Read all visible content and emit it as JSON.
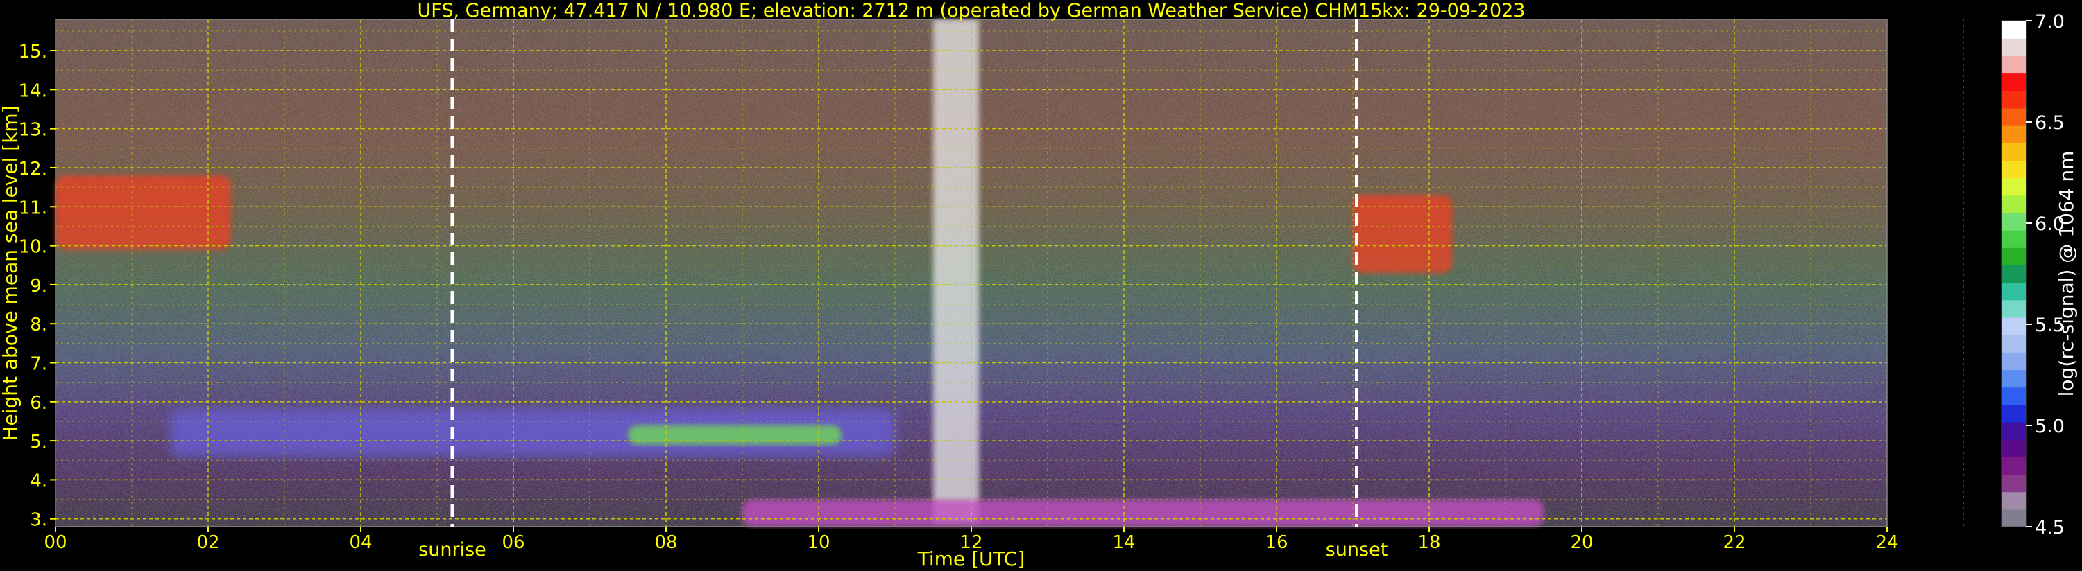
{
  "chart_data": {
    "type": "heatmap",
    "title": "UFS, Germany; 47.417 N / 10.980 E; elevation: 2712 m  (operated by German Weather Service)    CHM15kx: 29-09-2023",
    "xlabel": "Time [UTC]",
    "ylabel": "Height above mean sea level [km]",
    "xlim": [
      0,
      24
    ],
    "ylim": [
      2.8,
      15.8
    ],
    "x_ticks": [
      0,
      2,
      4,
      6,
      8,
      10,
      12,
      14,
      16,
      18,
      20,
      22,
      24
    ],
    "x_tick_labels": [
      "00",
      "02",
      "04",
      "06",
      "08",
      "10",
      "12",
      "14",
      "16",
      "18",
      "20",
      "22",
      "24"
    ],
    "y_ticks": [
      3,
      4,
      5,
      6,
      7,
      8,
      9,
      10,
      11,
      12,
      13,
      14,
      15
    ],
    "y_tick_labels": [
      "3.",
      "4.",
      "5.",
      "6.",
      "7.",
      "8.",
      "9.",
      "10.",
      "11.",
      "12.",
      "13.",
      "14.",
      "15."
    ],
    "grid": true,
    "colorbar": {
      "label": "log(rc-signal) @ 1064 nm",
      "range": [
        4.5,
        7.0
      ],
      "ticks": [
        4.5,
        5.0,
        5.5,
        6.0,
        6.5,
        7.0
      ],
      "tick_labels": [
        "4.5",
        "5.0",
        "5.5",
        "6.0",
        "6.5",
        "7.0"
      ],
      "colors": [
        "#7f7f8f",
        "#a08aa8",
        "#8a3a8a",
        "#7a1a86",
        "#5a0a8a",
        "#4010a0",
        "#1f2fd8",
        "#3060f0",
        "#5b8cf0",
        "#8aaaf0",
        "#a8c0f0",
        "#bcd0f8",
        "#78d8c8",
        "#30c0a0",
        "#189858",
        "#28b028",
        "#48d048",
        "#70e070",
        "#a8f040",
        "#d8f838",
        "#f8e020",
        "#f8c010",
        "#f89010",
        "#f86010",
        "#f83010",
        "#f81010",
        "#f0b0b0",
        "#e8d8d8",
        "#ffffff"
      ]
    },
    "annotations": [
      {
        "text": "sunrise",
        "x": 5.2
      },
      {
        "text": "sunset",
        "x": 17.05
      }
    ],
    "features": [
      {
        "kind": "cirrus",
        "t_start": 0.0,
        "t_end": 2.3,
        "h_low": 9.9,
        "h_high": 11.8
      },
      {
        "kind": "aerosol_layer",
        "t_start": 1.5,
        "t_end": 11.0,
        "h_low": 4.6,
        "h_high": 5.8
      },
      {
        "kind": "cloud_layer",
        "t_start": 7.5,
        "t_end": 10.3,
        "h_low": 4.9,
        "h_high": 5.4
      },
      {
        "kind": "precipitation_column",
        "t_start": 11.5,
        "t_end": 12.1,
        "h_low": 2.9,
        "h_high": 15.8
      },
      {
        "kind": "cirrus",
        "t_start": 17.0,
        "t_end": 18.3,
        "h_low": 9.3,
        "h_high": 11.3
      },
      {
        "kind": "boundary_layer",
        "t_start": 9.0,
        "t_end": 19.5,
        "h_low": 2.8,
        "h_high": 3.5
      }
    ]
  }
}
